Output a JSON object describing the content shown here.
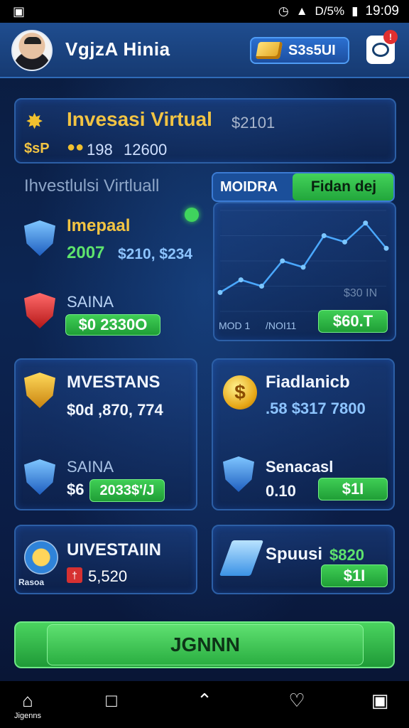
{
  "statusbar": {
    "left_icon": "camera-icon",
    "battery": "D/5%",
    "time": "19:09"
  },
  "header": {
    "username": "Vgjz​A Hinia",
    "coins": "S3s5UI"
  },
  "top_panel": {
    "title": "Invesasi Virtual",
    "amount": "$2101",
    "sub1": "$sP",
    "sub2": "198",
    "sub3": "12600"
  },
  "section_title": "Ihvestlulsi  Virtluall",
  "tabs": {
    "tab_a": "MOIDRA",
    "tab_b": "Fidan dej"
  },
  "left_panel": {
    "item1_title": "Imepaal",
    "item1_year": "2007",
    "item1_amount": "$210, $234",
    "item2_title": "SAINA",
    "item2_pill": "$0   2330O"
  },
  "chart_panel": {
    "label_x1": "MOD 1",
    "label_x2": "/NOI11",
    "corner": "$30 IN",
    "pill": "$60.T"
  },
  "chart_data": {
    "type": "line",
    "x": [
      1,
      2,
      3,
      4,
      5,
      6,
      7,
      8,
      9
    ],
    "values": [
      15,
      25,
      20,
      40,
      35,
      60,
      55,
      70,
      50
    ]
  },
  "mid_left": {
    "title1": "MVESTANS",
    "amount1": "$0d ,870, 774",
    "title2": "SAINA",
    "amount2_prefix": "$6",
    "pill": "2033$'/J"
  },
  "mid_right": {
    "title1": "Fiadlanicb",
    "amount1": ".58  $317 7800",
    "title2": "Senacasl",
    "amount2": "0.10",
    "pill": "$1I"
  },
  "bot_left": {
    "title": "UIVESTAIIN",
    "sub": "Rasoa",
    "badge": "†",
    "amount": "5,520"
  },
  "bot_right": {
    "title": "Spuusi",
    "amount": "$820",
    "pill": "$1I"
  },
  "cta": {
    "label": "JGNNN"
  },
  "navbar": {
    "home_label": "Jigenns"
  }
}
